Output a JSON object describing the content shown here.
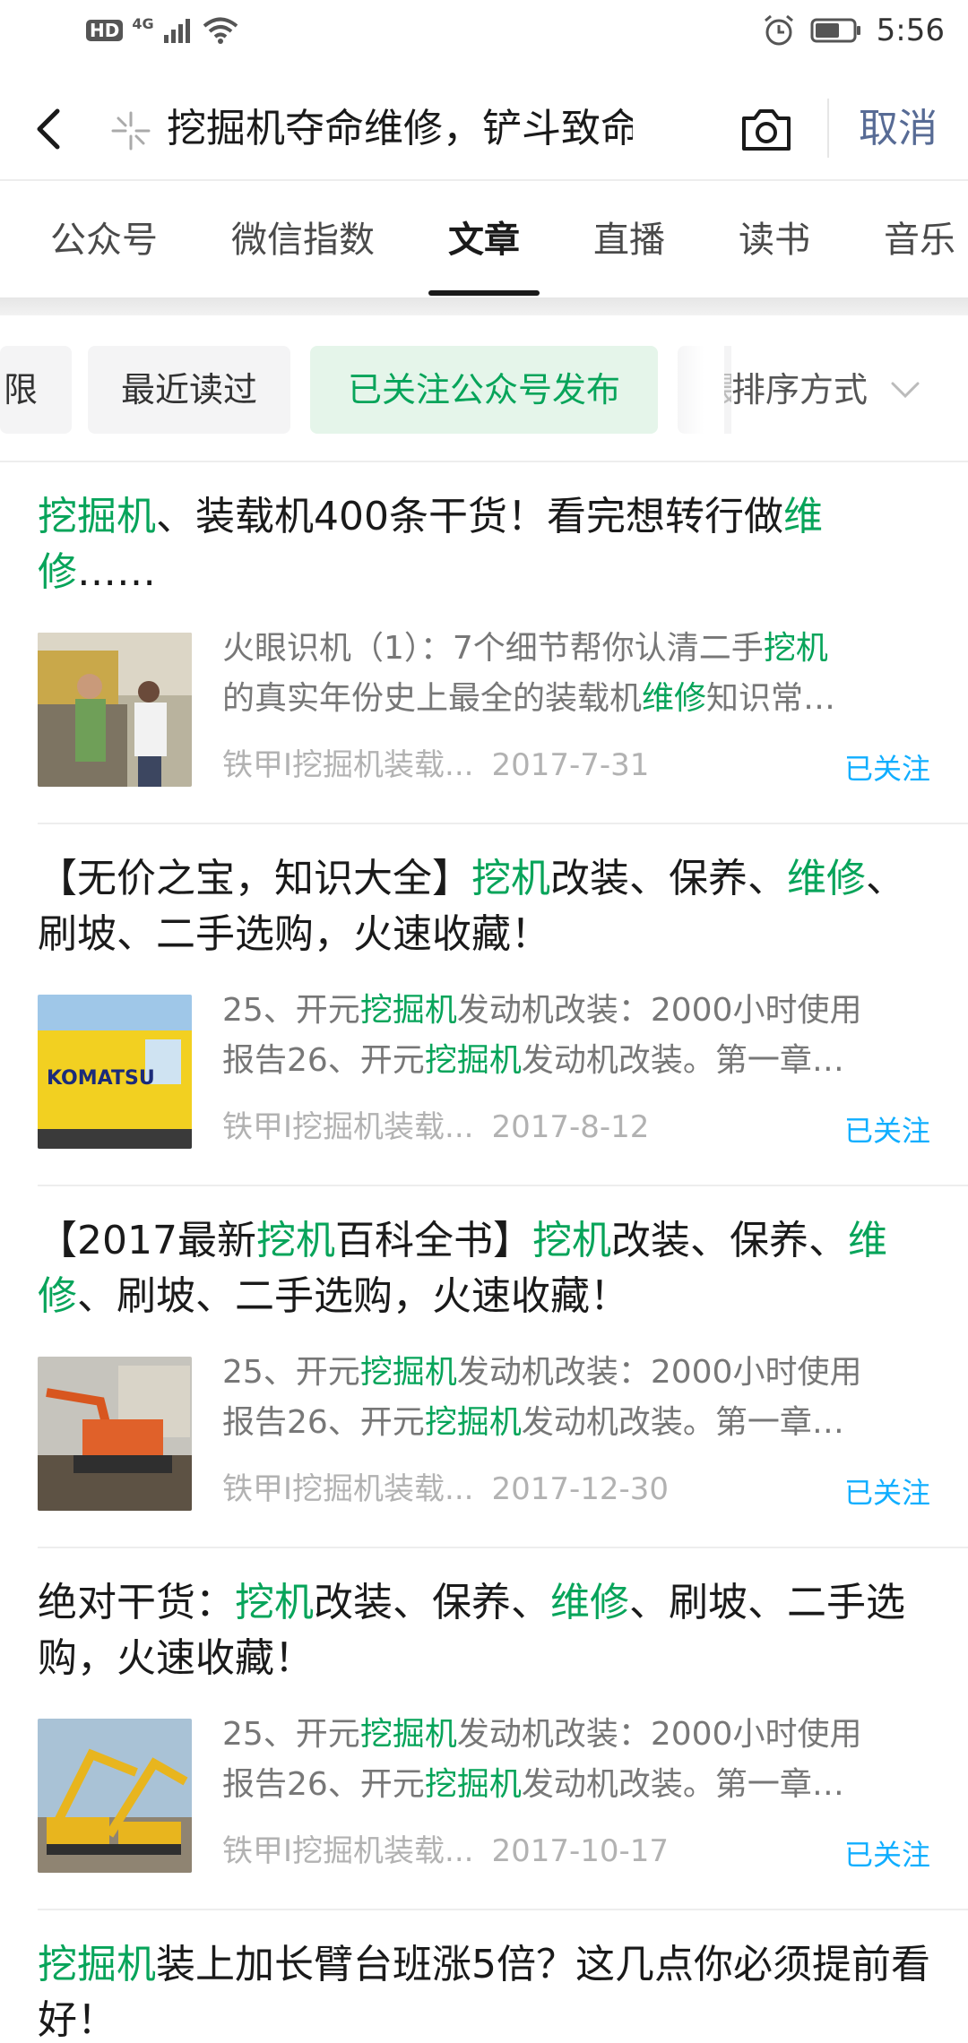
{
  "status_bar": {
    "hd": "HD",
    "network": "4G",
    "time": "5:56"
  },
  "search": {
    "query": "挖掘机夺命维修，铲斗致命回",
    "cancel": "取消"
  },
  "tabs": [
    "公众号",
    "微信指数",
    "文章",
    "直播",
    "读书",
    "音乐"
  ],
  "active_tab": "文章",
  "filters": {
    "chips": [
      "限",
      "最近读过",
      "已关注公众号发布",
      "最"
    ],
    "active_chip": "已关注公众号发布",
    "sort": "排序方式"
  },
  "colors": {
    "highlight": "#07a45a",
    "follow": "#10aeff",
    "cancel": "#576b95"
  },
  "articles": [
    {
      "title": [
        {
          "t": "挖掘机",
          "h": true
        },
        {
          "t": "、装载机400条干货！看完想转行做",
          "h": false
        },
        {
          "t": "维修",
          "h": true
        },
        {
          "t": "……",
          "h": false
        }
      ],
      "snippet_line1": [
        {
          "t": "火眼识机（1）：7个细节帮你认清二手",
          "h": false
        },
        {
          "t": "挖机",
          "h": true
        }
      ],
      "snippet_line2": [
        {
          "t": "的真实年份史上最全的装载机",
          "h": false
        },
        {
          "t": "维修",
          "h": true
        },
        {
          "t": "知识常…",
          "h": false
        }
      ],
      "source": "铁甲I挖掘机装载...",
      "date": "2017-7-31",
      "follow": "已关注",
      "thumb": "people-at-excavator"
    },
    {
      "title": [
        {
          "t": "【无价之宝，知识大全】",
          "h": false
        },
        {
          "t": "挖机",
          "h": true
        },
        {
          "t": "改装、保养、",
          "h": false
        },
        {
          "t": "维修",
          "h": true
        },
        {
          "t": "、刷坡、二手选购，火速收藏！",
          "h": false
        }
      ],
      "snippet_line1": [
        {
          "t": "25、开元",
          "h": false
        },
        {
          "t": "挖掘机",
          "h": true
        },
        {
          "t": "发动机改装：2000小时使用",
          "h": false
        }
      ],
      "snippet_line2": [
        {
          "t": "报告26、开元",
          "h": false
        },
        {
          "t": "挖掘机",
          "h": true
        },
        {
          "t": "发动机改装。第一章…",
          "h": false
        }
      ],
      "source": "铁甲I挖掘机装载...",
      "date": "2017-8-12",
      "follow": "已关注",
      "thumb": "komatsu-excavator",
      "thumb_text": "KOMATSU"
    },
    {
      "title": [
        {
          "t": "【2017最新",
          "h": false
        },
        {
          "t": "挖机",
          "h": true
        },
        {
          "t": "百科全书】",
          "h": false
        },
        {
          "t": "挖机",
          "h": true
        },
        {
          "t": "改装、保养、",
          "h": false
        },
        {
          "t": "维修",
          "h": true
        },
        {
          "t": "、刷坡、二手选购，火速收藏！",
          "h": false
        }
      ],
      "snippet_line1": [
        {
          "t": "25、开元",
          "h": false
        },
        {
          "t": "挖掘机",
          "h": true
        },
        {
          "t": "发动机改装：2000小时使用",
          "h": false
        }
      ],
      "snippet_line2": [
        {
          "t": "报告26、开元",
          "h": false
        },
        {
          "t": "挖掘机",
          "h": true
        },
        {
          "t": "发动机改装。第一章…",
          "h": false
        }
      ],
      "source": "铁甲I挖掘机装载...",
      "date": "2017-12-30",
      "follow": "已关注",
      "thumb": "orange-excavator"
    },
    {
      "title": [
        {
          "t": "绝对干货：",
          "h": false
        },
        {
          "t": "挖机",
          "h": true
        },
        {
          "t": "改装、保养、",
          "h": false
        },
        {
          "t": "维修",
          "h": true
        },
        {
          "t": "、刷坡、二手选购，火速收藏！",
          "h": false
        }
      ],
      "snippet_line1": [
        {
          "t": "25、开元",
          "h": false
        },
        {
          "t": "挖掘机",
          "h": true
        },
        {
          "t": "发动机改装：2000小时使用",
          "h": false
        }
      ],
      "snippet_line2": [
        {
          "t": "报告26、开元",
          "h": false
        },
        {
          "t": "挖掘机",
          "h": true
        },
        {
          "t": "发动机改装。第一章…",
          "h": false
        }
      ],
      "source": "铁甲I挖掘机装载...",
      "date": "2017-10-17",
      "follow": "已关注",
      "thumb": "yellow-excavators"
    },
    {
      "title": [
        {
          "t": "挖掘机",
          "h": true
        },
        {
          "t": "装上加长臂台班涨5倍？这几点你必须提前看好！",
          "h": false
        }
      ]
    }
  ]
}
